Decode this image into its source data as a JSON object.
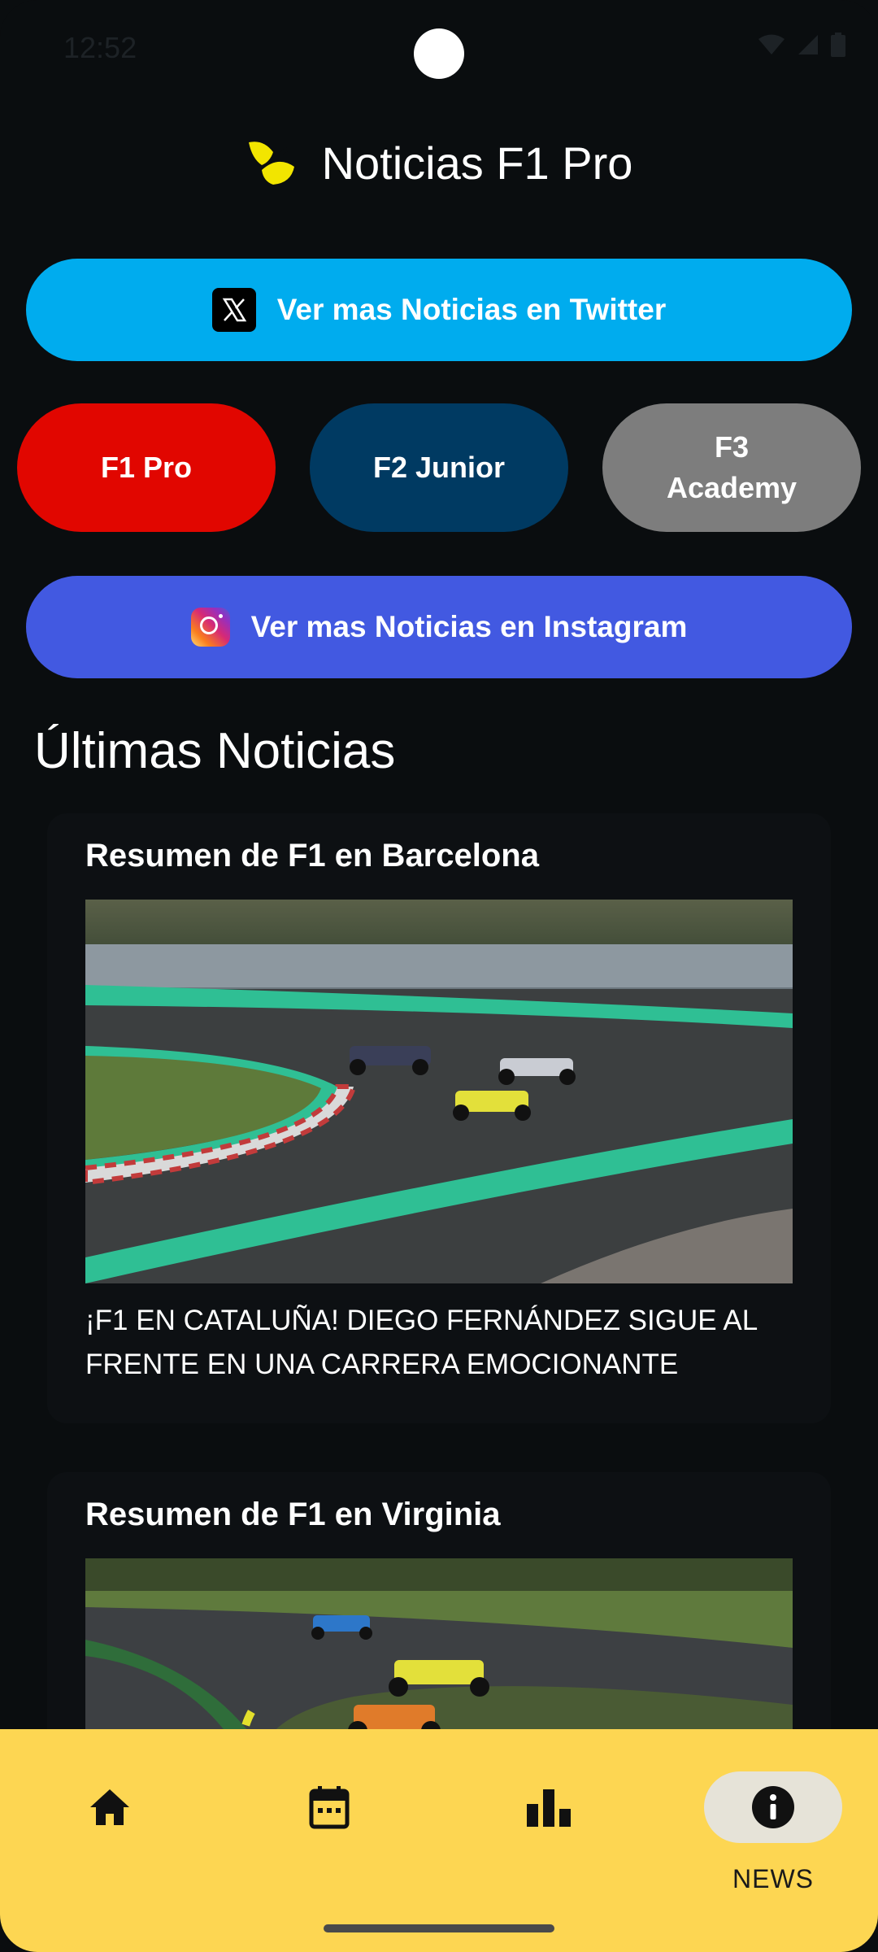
{
  "status_bar": {
    "time": "12:52"
  },
  "header": {
    "title": "Noticias F1 Pro",
    "logo_icon": "helmet-wing-logo"
  },
  "social": {
    "twitter_label": "Ver mas Noticias en Twitter",
    "instagram_label": "Ver mas Noticias en Instagram"
  },
  "categories": [
    {
      "label": "F1 Pro",
      "color": "#e10600"
    },
    {
      "label": "F2 Junior",
      "color": "#003a62"
    },
    {
      "label": "F3 Academy",
      "color": "#7d7d7d"
    }
  ],
  "section_title": "Últimas Noticias",
  "news": [
    {
      "title": "Resumen de F1 en Barcelona",
      "description": "¡F1 EN CATALUÑA! DIEGO FERNÁNDEZ SIGUE AL FRENTE EN UNA CARRERA EMOCIONANTE"
    },
    {
      "title": "Resumen de F1 en Virginia",
      "description": ""
    }
  ],
  "bottom_nav": {
    "items": [
      {
        "icon": "home-icon",
        "label": ""
      },
      {
        "icon": "calendar-icon",
        "label": ""
      },
      {
        "icon": "bar-chart-icon",
        "label": ""
      },
      {
        "icon": "info-icon",
        "label": "NEWS",
        "active": true
      }
    ]
  },
  "colors": {
    "background": "#0a0d0f",
    "twitter": "#00acee",
    "instagram": "#4259e1",
    "nav_bar": "#fdd652",
    "accent_yellow": "#f2e500"
  }
}
